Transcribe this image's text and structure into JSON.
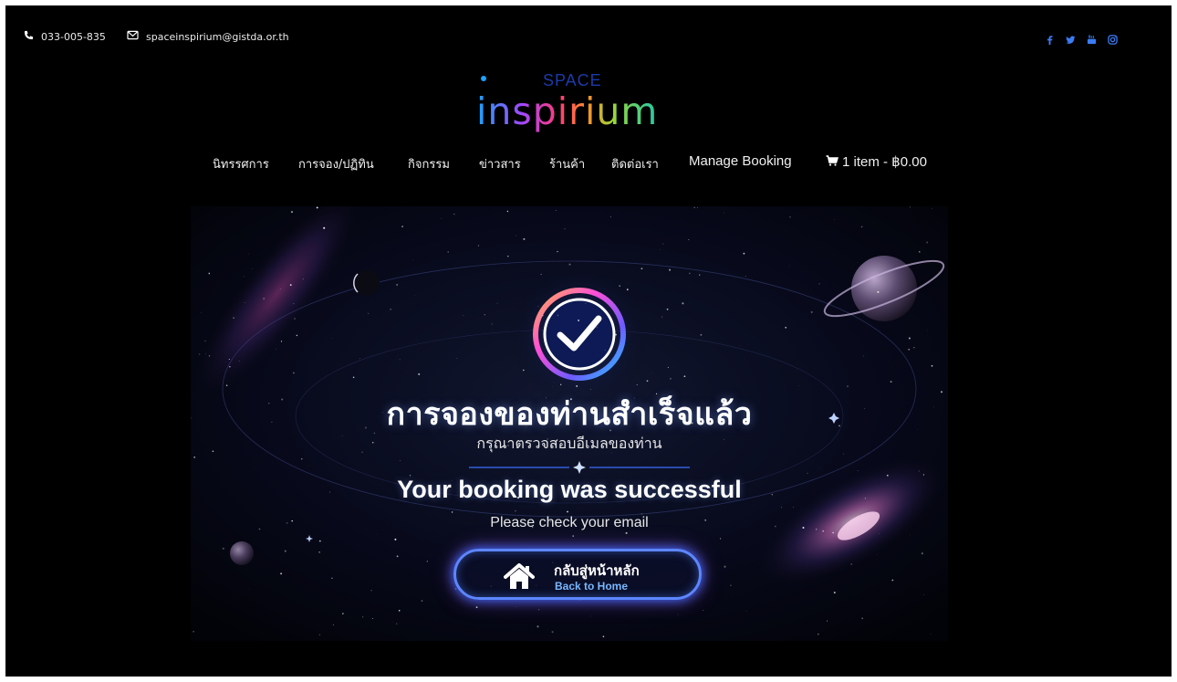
{
  "topbar": {
    "phone": "033-005-835",
    "email": "spaceinspirium@gistda.or.th",
    "social": [
      "facebook-icon",
      "twitter-icon",
      "youtube-icon",
      "instagram-icon"
    ]
  },
  "logo": {
    "top": "SPACE",
    "main": "inspirium"
  },
  "nav": {
    "items": [
      "นิทรรศการ",
      "การจอง/ปฏิทิน",
      "กิจกรรม",
      "ข่าวสาร",
      "ร้านค้า",
      "ติดต่อเรา",
      "Manage Booking"
    ],
    "cart": "1 item - ฿0.00"
  },
  "hero": {
    "title_th": "การจองของท่านสำเร็จแล้ว",
    "subtitle_th": "กรุณาตรวจสอบอีเมลของท่าน",
    "title_en": "Your booking was successful",
    "subtitle_en": "Please check your email",
    "button_th": "กลับสู่หน้าหลัก",
    "button_en": "Back to Home"
  },
  "colors": {
    "background": "#000000",
    "button_border": "#5d86ff",
    "button_subtext": "#79b7ff"
  }
}
